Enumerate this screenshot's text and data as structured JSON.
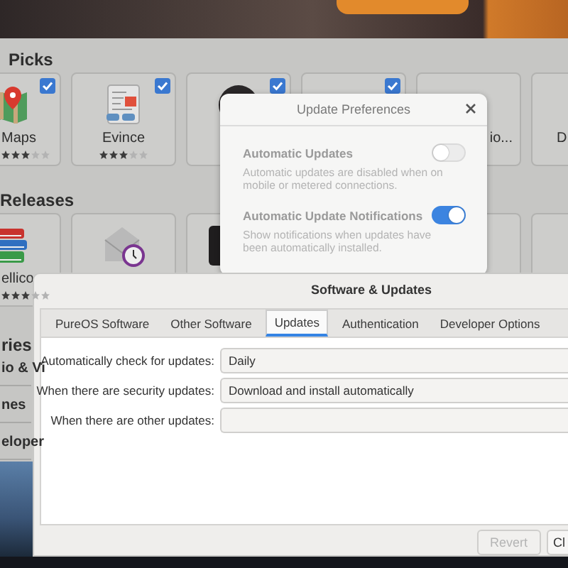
{
  "software_center": {
    "sections": [
      {
        "heading": "Picks",
        "apps": [
          {
            "name": "Maps",
            "stars": 3,
            "checked": true
          },
          {
            "name": "Evince",
            "stars": 3,
            "checked": true
          },
          {
            "checked": true
          },
          {
            "checked": true
          },
          {
            "name": "io...",
            "checked": false
          },
          {
            "name": "D"
          }
        ]
      },
      {
        "heading": "Releases",
        "apps": [
          {
            "name": "ellico",
            "stars": 3
          }
        ]
      }
    ]
  },
  "categories": {
    "heading": "ries",
    "items": [
      "io & Vi",
      "nes",
      "eloper"
    ]
  },
  "update_preferences": {
    "title": "Update Preferences",
    "rows": [
      {
        "label": "Automatic Updates",
        "description": "Automatic updates are disabled when on mobile or metered connections.",
        "on": false
      },
      {
        "label": "Automatic Update Notifications",
        "description": "Show notifications when updates have been automatically installed.",
        "on": true
      }
    ]
  },
  "software_updates": {
    "title": "Software & Updates",
    "tabs": [
      {
        "label": "PureOS Software",
        "selected": false
      },
      {
        "label": "Other Software",
        "selected": false
      },
      {
        "label": "Updates",
        "selected": true
      },
      {
        "label": "Authentication",
        "selected": false
      },
      {
        "label": "Developer Options",
        "selected": false
      }
    ],
    "settings": [
      {
        "label": "Automatically check for updates:",
        "value": "Daily"
      },
      {
        "label": "When there are security updates:",
        "value": "Download and install automatically"
      },
      {
        "label": "When there are other updates:"
      }
    ],
    "buttons": [
      {
        "label": "Revert",
        "disabled": true
      },
      {
        "label": "Cl",
        "disabled": false
      }
    ]
  }
}
